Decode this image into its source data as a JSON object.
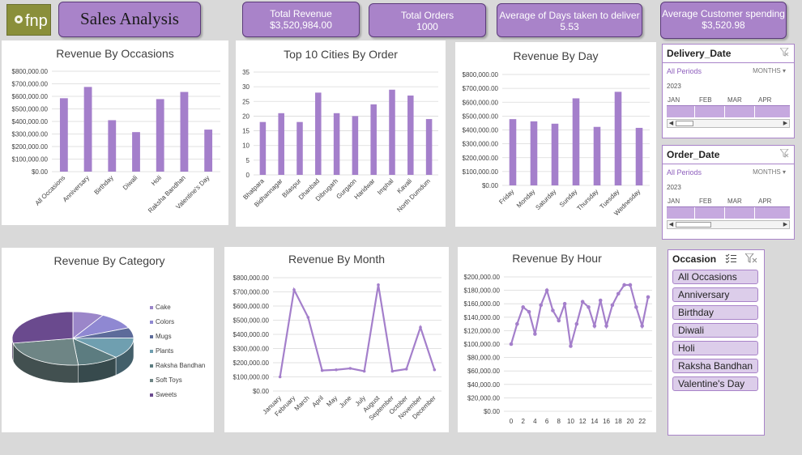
{
  "header": {
    "logo_text": "fnp",
    "title": "Sales Analysis",
    "kpis": [
      {
        "label": "Total Revenue",
        "value": "$3,520,984.00"
      },
      {
        "label": "Total Orders",
        "value": "1000"
      },
      {
        "label": "Average of Days taken to deliver",
        "value": "5.53"
      },
      {
        "label": "Average Customer spending",
        "value": "$3,520.98"
      }
    ]
  },
  "slicers": {
    "delivery": {
      "title": "Delivery_Date",
      "all_periods": "All Periods",
      "mode": "MONTHS",
      "year": "2023",
      "months": [
        "JAN",
        "FEB",
        "MAR",
        "APR"
      ]
    },
    "order": {
      "title": "Order_Date",
      "all_periods": "All Periods",
      "mode": "MONTHS",
      "year": "2023",
      "months": [
        "JAN",
        "FEB",
        "MAR",
        "APR"
      ]
    },
    "occasion": {
      "title": "Occasion",
      "items": [
        "All Occasions",
        "Anniversary",
        "Birthday",
        "Diwali",
        "Holi",
        "Raksha Bandhan",
        "Valentine's Day"
      ]
    }
  },
  "colors": {
    "accent": "#a983c9",
    "bar": "#a47fcb",
    "header_border": "#5b3a7a"
  },
  "chart_data": [
    {
      "id": "occasions",
      "type": "bar",
      "title": "Revenue By Occasions",
      "categories": [
        "All Occasions",
        "Anniversary",
        "Birthday",
        "Diwali",
        "Holi",
        "Raksha Bandhan",
        "Valentine's Day"
      ],
      "values": [
        585000,
        675000,
        410000,
        315000,
        578000,
        635000,
        335000
      ],
      "ylim": [
        0,
        800000
      ],
      "yticks": [
        "$0.00",
        "$100,000.00",
        "$200,000.00",
        "$300,000.00",
        "$400,000.00",
        "$500,000.00",
        "$600,000.00",
        "$700,000.00",
        "$800,000.00"
      ]
    },
    {
      "id": "cities",
      "type": "bar",
      "title": "Top 10 Cities By Order",
      "categories": [
        "Bhatpara",
        "Bidhannagar",
        "Bilaspur",
        "Dhanbad",
        "Dibrugarh",
        "Gurgaon",
        "Haridwar",
        "Imphal",
        "Kavali",
        "North Dumdum"
      ],
      "values": [
        18,
        21,
        18,
        28,
        21,
        20,
        24,
        29,
        27,
        19
      ],
      "ylim": [
        0,
        35
      ],
      "yticks": [
        "0",
        "5",
        "10",
        "15",
        "20",
        "25",
        "30",
        "35"
      ]
    },
    {
      "id": "day",
      "type": "bar",
      "title": "Revenue By Day",
      "categories": [
        "Friday",
        "Monday",
        "Saturday",
        "Sunday",
        "Thursday",
        "Tuesday",
        "Wednesday"
      ],
      "values": [
        478000,
        462000,
        445000,
        628000,
        422000,
        675000,
        415000
      ],
      "ylim": [
        0,
        800000
      ],
      "yticks": [
        "$0.00",
        "$100,000.00",
        "$200,000.00",
        "$300,000.00",
        "$400,000.00",
        "$500,000.00",
        "$600,000.00",
        "$700,000.00",
        "$800,000.00"
      ]
    },
    {
      "id": "category",
      "type": "pie",
      "title": "Revenue By Category",
      "categories": [
        "Cake",
        "Colors",
        "Mugs",
        "Plants",
        "Raksha Bandhan",
        "Soft Toys",
        "Sweets"
      ],
      "values": [
        290000,
        360000,
        220000,
        450000,
        390000,
        830000,
        980000
      ],
      "colors": [
        "#9b86c9",
        "#8f88d2",
        "#5d6b9a",
        "#6f9fb0",
        "#5c7c80",
        "#6e8585",
        "#6a4a8e"
      ]
    },
    {
      "id": "month",
      "type": "line",
      "title": "Revenue By Month",
      "categories": [
        "January",
        "February",
        "March",
        "April",
        "May",
        "June",
        "July",
        "August",
        "September",
        "October",
        "November",
        "December"
      ],
      "values": [
        100000,
        715000,
        520000,
        145000,
        150000,
        160000,
        140000,
        750000,
        140000,
        155000,
        450000,
        150000
      ],
      "ylim": [
        0,
        800000
      ],
      "yticks": [
        "$0.00",
        "$100,000.00",
        "$200,000.00",
        "$300,000.00",
        "$400,000.00",
        "$500,000.00",
        "$600,000.00",
        "$700,000.00",
        "$800,000.00"
      ]
    },
    {
      "id": "hour",
      "type": "line",
      "title": "Revenue By Hour",
      "x": [
        0,
        1,
        2,
        3,
        4,
        5,
        6,
        7,
        8,
        9,
        10,
        11,
        12,
        13,
        14,
        15,
        16,
        17,
        18,
        19,
        20,
        21,
        22,
        23
      ],
      "values": [
        100000,
        130000,
        155000,
        148000,
        115000,
        158000,
        180000,
        150000,
        135000,
        160000,
        97000,
        130000,
        163000,
        155000,
        127000,
        165000,
        127000,
        158000,
        175000,
        188000,
        188000,
        155000,
        127000,
        170000
      ],
      "ylim": [
        0,
        200000
      ],
      "xticks": [
        "0",
        "2",
        "4",
        "6",
        "8",
        "10",
        "12",
        "14",
        "16",
        "18",
        "20",
        "22"
      ],
      "yticks": [
        "$0.00",
        "$20,000.00",
        "$40,000.00",
        "$60,000.00",
        "$80,000.00",
        "$100,000.00",
        "$120,000.00",
        "$140,000.00",
        "$160,000.00",
        "$180,000.00",
        "$200,000.00"
      ]
    }
  ]
}
